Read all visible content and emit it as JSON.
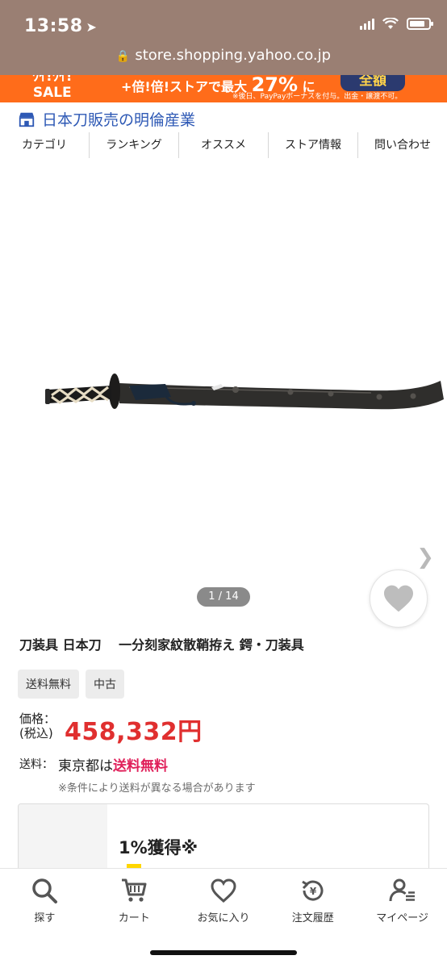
{
  "status": {
    "time": "13:58"
  },
  "browser": {
    "url": "store.shopping.yahoo.co.jp"
  },
  "banner": {
    "sale_line1": "ﾜｲ!ﾜｲ!",
    "sale_line2": "SALE",
    "promo_prefix": "+倍!倍!ストアで最大",
    "promo_rate": "27%",
    "promo_suffix": "に",
    "note": "※後日、PayPayボーナスを付与。出金・譲渡不可。",
    "badge": "全額"
  },
  "store": {
    "name": "日本刀販売の明倫産業"
  },
  "nav": {
    "tabs": [
      "カテゴリ",
      "ランキング",
      "オススメ",
      "ストア情報",
      "問い合わせ"
    ]
  },
  "gallery": {
    "pager": "1 / 14"
  },
  "product": {
    "title": "刀装具 日本刀　 一分刻家紋散鞘拵え 鍔・刀装具",
    "tags": [
      "送料無料",
      "中古"
    ],
    "price_label_1": "価格：",
    "price_label_2": "(税込)",
    "price": "458,332円",
    "shipping_label": "送料：",
    "shipping_region": "東京都は",
    "shipping_free": "送料無料",
    "shipping_note": "※条件により送料が異なる場合があります"
  },
  "points": {
    "rate": "1%獲得※"
  },
  "tabbar": {
    "items": [
      {
        "label": "探す",
        "icon": "search-icon"
      },
      {
        "label": "カート",
        "icon": "cart-icon"
      },
      {
        "label": "お気に入り",
        "icon": "heart-icon"
      },
      {
        "label": "注文履歴",
        "icon": "history-icon"
      },
      {
        "label": "マイページ",
        "icon": "user-icon"
      }
    ]
  },
  "colors": {
    "topbar": "#9a7f73",
    "banner": "#ff6c1a",
    "store_link": "#2e59b5",
    "price": "#e02f2f",
    "free_shipping": "#e0205a"
  }
}
